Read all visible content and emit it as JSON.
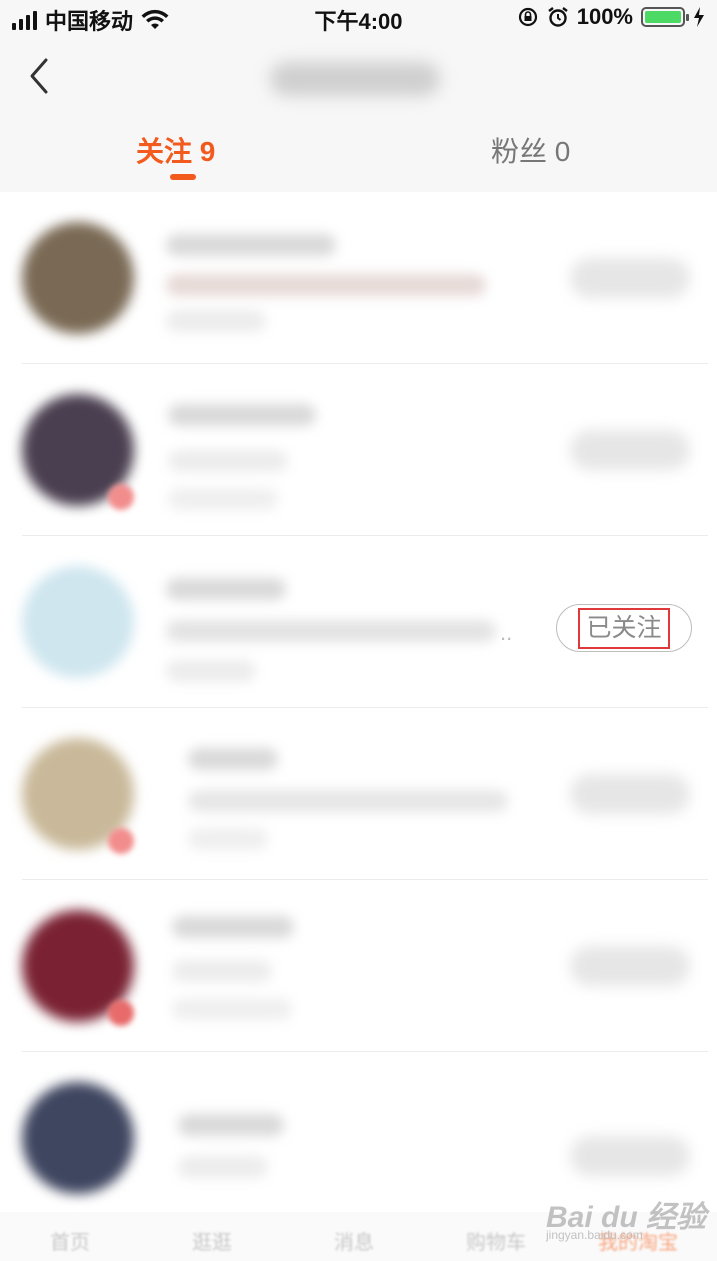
{
  "status_bar": {
    "carrier": "中国移动",
    "time": "下午4:00",
    "battery_percent": "100%",
    "battery_level": 1.0,
    "icons": [
      "signal-icon",
      "wifi-icon",
      "orientation-lock-icon",
      "alarm-icon",
      "battery-icon",
      "charging-icon"
    ]
  },
  "nav": {
    "back_icon": "chevron-left-icon"
  },
  "tabs": [
    {
      "label": "关注 9",
      "active": true
    },
    {
      "label": "粉丝 0",
      "active": false
    }
  ],
  "list": {
    "rows": [
      {
        "avatar_color": "#7a6a55"
      },
      {
        "avatar_color": "#4a3f50"
      },
      {
        "avatar_color": "#cfe6ef",
        "follow_label": "已关注",
        "ellipsis": ".."
      },
      {
        "avatar_color": "#c9b99a"
      },
      {
        "avatar_color": "#7a2233"
      },
      {
        "avatar_color": "#3f4660"
      }
    ]
  },
  "bottom_tabs": [
    {
      "label": "首页"
    },
    {
      "label": "逛逛"
    },
    {
      "label": "消息"
    },
    {
      "label": "购物车"
    },
    {
      "label": "我的淘宝"
    }
  ],
  "watermark": {
    "text": "Bai du 经验",
    "sub": "jingyan.baidu.com"
  },
  "colors": {
    "accent": "#f25a1e",
    "highlight_box": "#e0393c"
  }
}
